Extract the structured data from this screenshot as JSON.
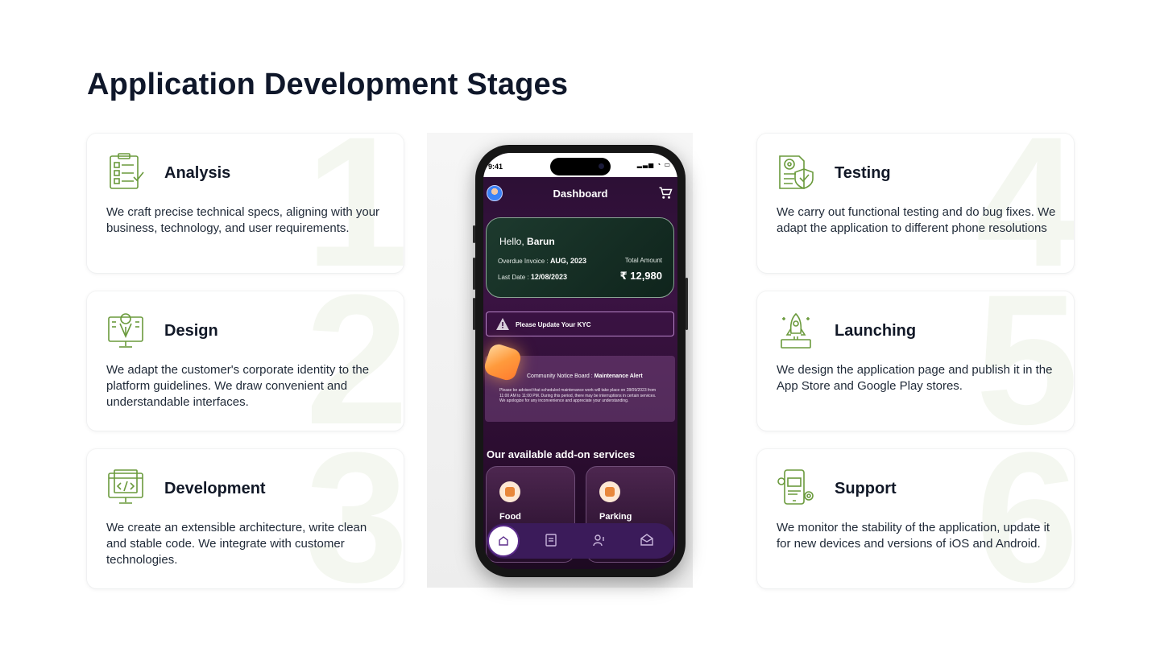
{
  "page": {
    "title": "Application Development Stages"
  },
  "stages": [
    {
      "number": "1",
      "title": "Analysis",
      "description": "We craft precise technical specs, aligning with your business, technology, and user requirements.",
      "icon": "analysis-icon"
    },
    {
      "number": "2",
      "title": "Design",
      "description": "We adapt the customer's corporate identity to the platform guidelines. We draw convenient and understandable interfaces.",
      "icon": "design-icon"
    },
    {
      "number": "3",
      "title": "Development",
      "description": "We create an extensible architecture, write clean and stable code. We integrate with customer technologies.",
      "icon": "code-icon"
    },
    {
      "number": "4",
      "title": "Testing",
      "description": "We carry out functional testing and do bug fixes. We adapt the application to different phone resolutions",
      "icon": "testing-icon"
    },
    {
      "number": "5",
      "title": "Launching",
      "description": "We design the application page and publish it in the App Store and Google Play stores.",
      "icon": "rocket-icon"
    },
    {
      "number": "6",
      "title": "Support",
      "description": "We monitor the stability of the application, update it for new devices and versions of iOS and Android.",
      "icon": "support-icon"
    }
  ],
  "phone": {
    "status_time": "9:41",
    "dashboard_title": "Dashboard",
    "greeting_prefix": "Hello,",
    "user_name": "Barun",
    "overdue_label": "Overdue Invoice :",
    "overdue_value": "AUG, 2023",
    "total_label": "Total Amount",
    "last_date_label": "Last Date :",
    "last_date_value": "12/08/2023",
    "total_amount": "₹ 12,980",
    "kyc_text": "Please Update Your KYC",
    "notice_prefix": "Community Notice Board :",
    "notice_title": "Maintenance Alert",
    "notice_body": "Please be advised that scheduled maintenance work will take place on 28/09/2023 from 11:00 AM to 11:00 PM. During this period, there may be interruptions in certain services. We apologize for any inconvenience and appreciate your understanding.",
    "addons_title": "Our available add-on services",
    "services": [
      {
        "label": "Food",
        "icon": "food-icon"
      },
      {
        "label": "Parking",
        "icon": "parking-icon"
      }
    ],
    "tabs": [
      "home-icon",
      "document-icon",
      "people-icon",
      "mail-icon"
    ]
  },
  "colors": {
    "accent_green": "#6a9a3c",
    "watermark": "#f4f7f0",
    "phone_bg": "#2a0f33"
  }
}
